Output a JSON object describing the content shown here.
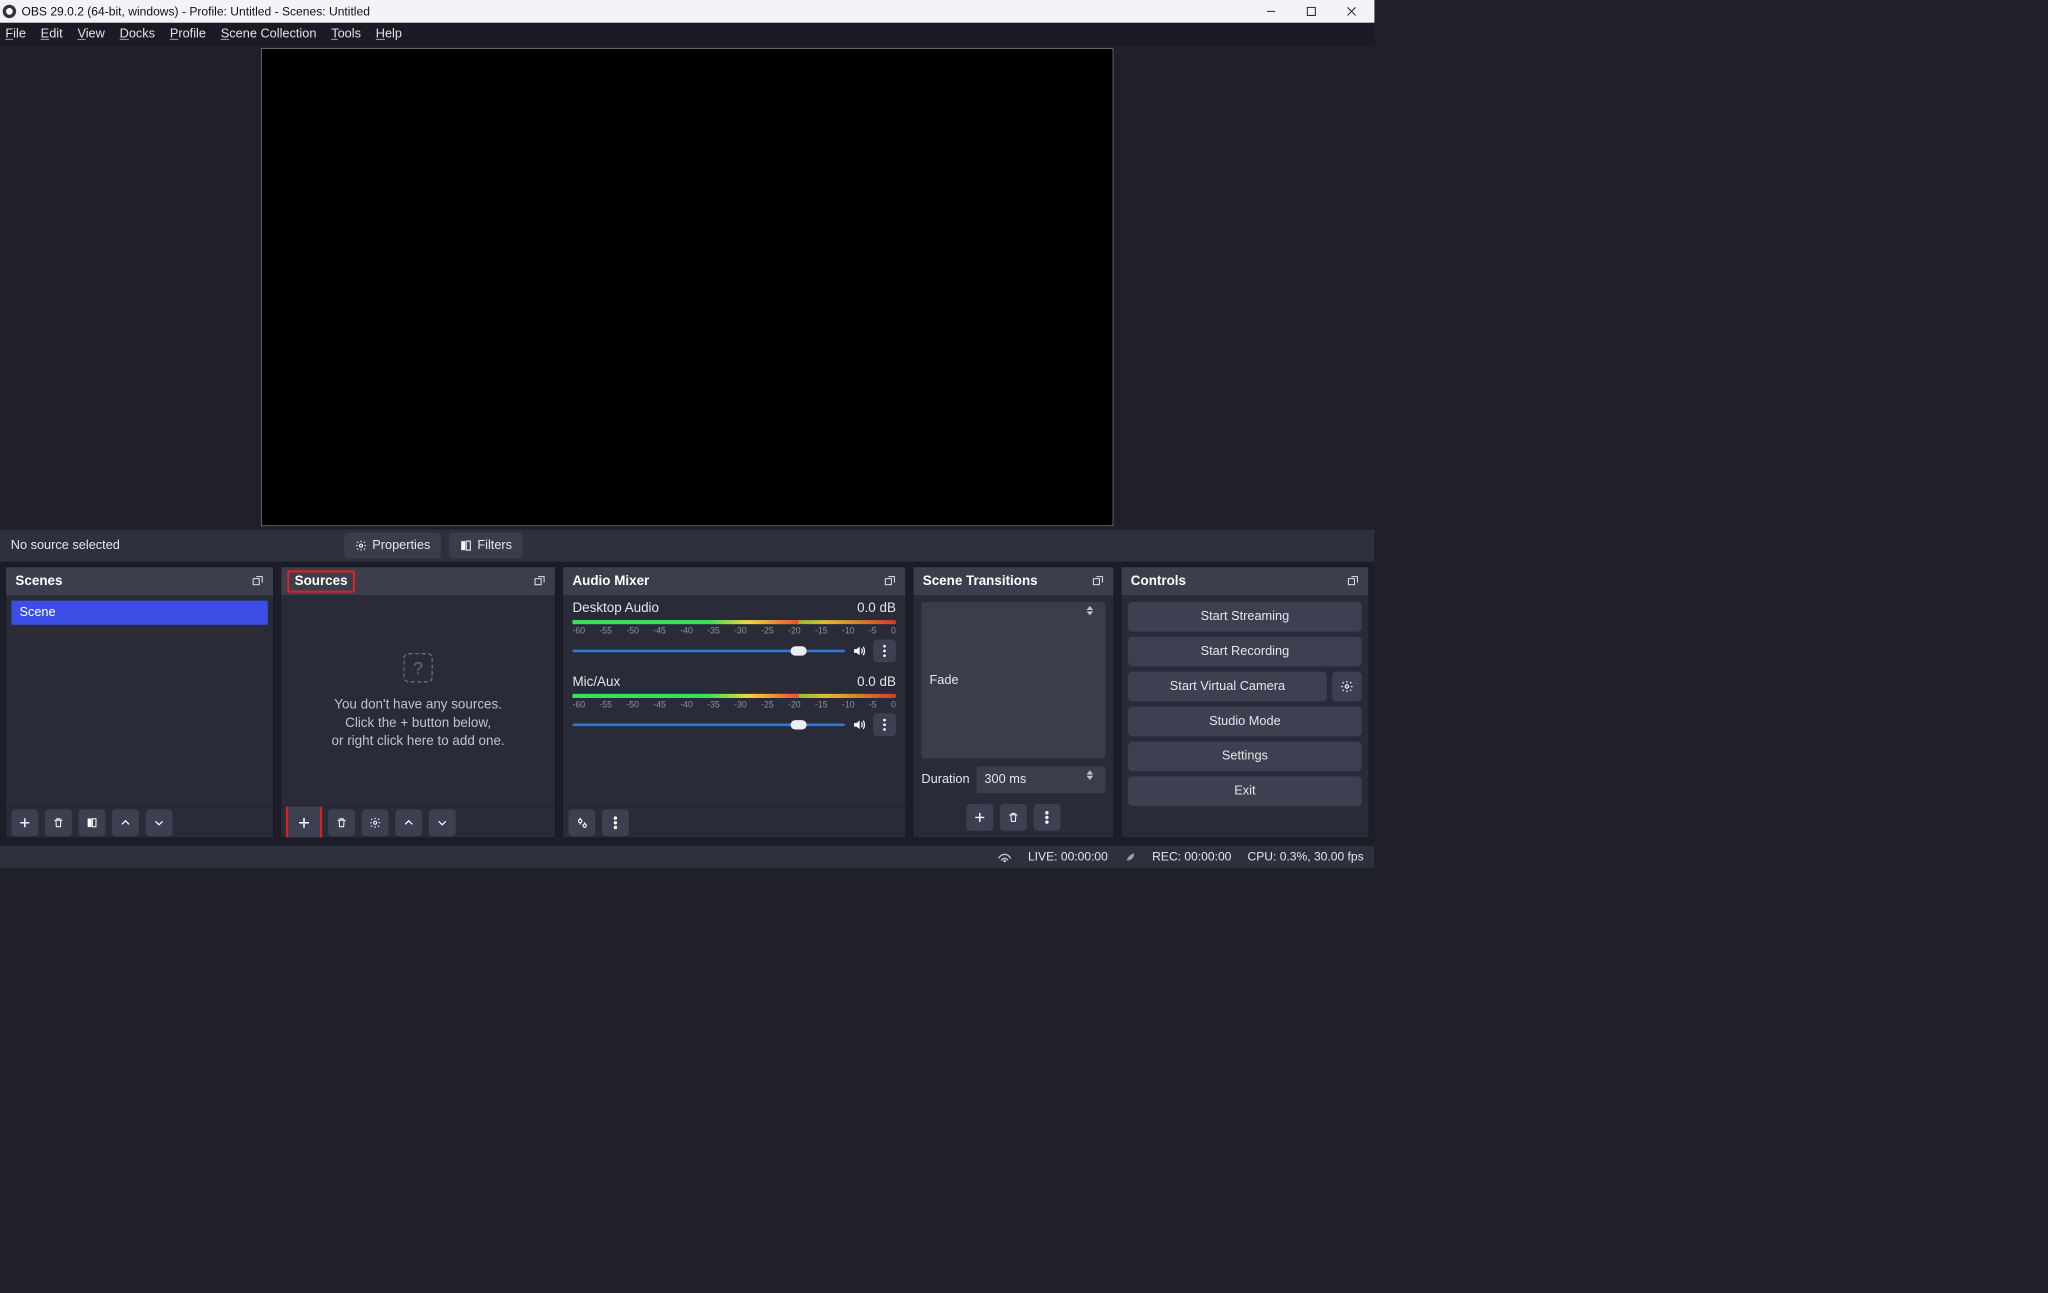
{
  "window_title": "OBS 29.0.2 (64-bit, windows) - Profile: Untitled - Scenes: Untitled",
  "menubar": {
    "file": "File",
    "edit": "Edit",
    "view": "View",
    "docks": "Docks",
    "profile": "Profile",
    "scene_collection": "Scene Collection",
    "tools": "Tools",
    "help": "Help"
  },
  "source_bar": {
    "status": "No source selected",
    "properties": "Properties",
    "filters": "Filters"
  },
  "scenes": {
    "title": "Scenes",
    "items": [
      "Scene"
    ]
  },
  "sources": {
    "title": "Sources",
    "empty1": "You don't have any sources.",
    "empty2": "Click the + button below,",
    "empty3": "or right click here to add one."
  },
  "mixer": {
    "title": "Audio Mixer",
    "ticks": [
      "-60",
      "-55",
      "-50",
      "-45",
      "-40",
      "-35",
      "-30",
      "-25",
      "-20",
      "-15",
      "-10",
      "-5",
      "0"
    ],
    "channels": [
      {
        "name": "Desktop Audio",
        "level": "0.0 dB"
      },
      {
        "name": "Mic/Aux",
        "level": "0.0 dB"
      }
    ]
  },
  "transitions": {
    "title": "Scene Transitions",
    "selected": "Fade",
    "duration_label": "Duration",
    "duration_value": "300 ms"
  },
  "controls": {
    "title": "Controls",
    "start_streaming": "Start Streaming",
    "start_recording": "Start Recording",
    "start_vcam": "Start Virtual Camera",
    "studio_mode": "Studio Mode",
    "settings": "Settings",
    "exit": "Exit"
  },
  "status": {
    "live": "LIVE: 00:00:00",
    "rec": "REC: 00:00:00",
    "cpu": "CPU: 0.3%, 30.00 fps"
  }
}
